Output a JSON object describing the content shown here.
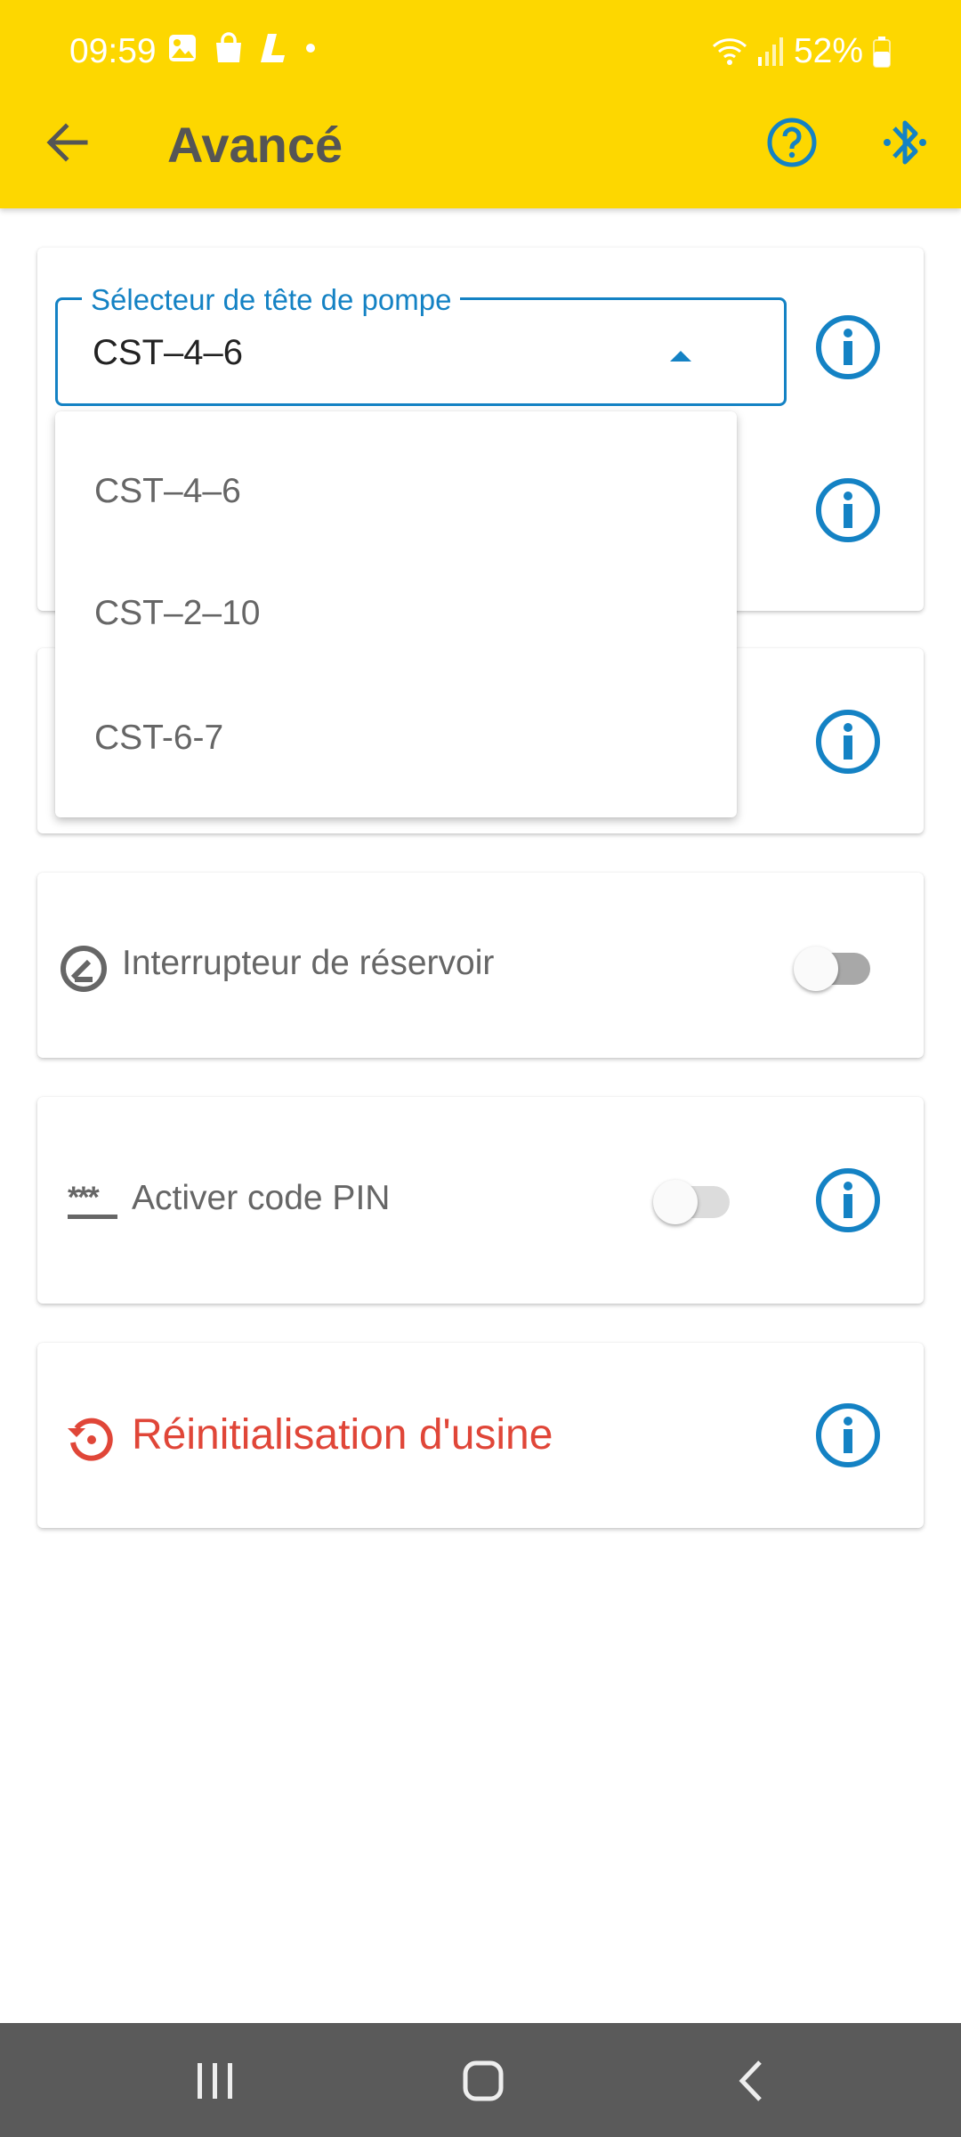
{
  "status_bar": {
    "time": "09:59",
    "battery": "52%",
    "left_icons": [
      "gallery-icon",
      "shopping-bag-icon",
      "l-app-icon",
      "dot-icon"
    ],
    "right_icons": [
      "wifi-icon",
      "signal-icon",
      "battery-icon"
    ]
  },
  "appbar": {
    "title": "Avancé",
    "background_color": "#FDD700",
    "accent_color": "#1482C4"
  },
  "pump_head_selector": {
    "label": "Sélecteur de tête de pompe",
    "selected": "CST–4–6",
    "options": [
      "CST–4–6",
      "CST–2–10",
      "CST-6-7"
    ]
  },
  "tank_switch": {
    "label": "Interrupteur de réservoir",
    "enabled": false
  },
  "pin_code": {
    "label": "Activer code PIN",
    "icon_text": "***",
    "enabled": false
  },
  "factory_reset": {
    "label": "Réinitialisation d'usine",
    "color": "#E04638"
  }
}
